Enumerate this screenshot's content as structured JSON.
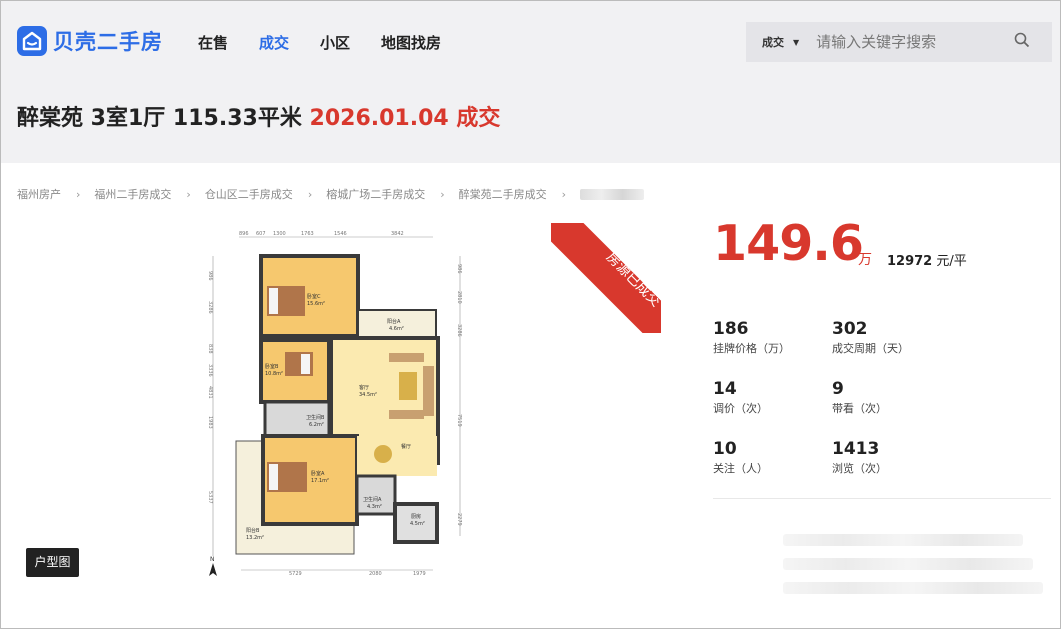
{
  "header": {
    "logo_text": "贝壳二手房",
    "nav": [
      "在售",
      "成交",
      "小区",
      "地图找房"
    ],
    "active_nav": "成交",
    "search": {
      "type_label": "成交",
      "placeholder": "请输入关键字搜索"
    }
  },
  "listing": {
    "name": "醉棠苑 3室1厅 115.33平米",
    "deal_date": "2026.01.04 成交"
  },
  "breadcrumb": [
    "福州房产",
    "福州二手房成交",
    "仓山区二手房成交",
    "榕城广场二手房成交",
    "醉棠苑二手房成交"
  ],
  "badge": {
    "sold": "房源已成交",
    "floorplan_tag": "户型图"
  },
  "floorplan": {
    "rooms": [
      "卧室C",
      "卧室B",
      "卧室A",
      "阳台A",
      "阳台B",
      "客厅",
      "餐厅",
      "卫生间B",
      "卫生间A",
      "厨房"
    ],
    "areas": [
      "15.6m²",
      "10.8m²",
      "17.1m²",
      "4.6m²",
      "13.2m²",
      "34.5m²",
      "6.2m²",
      "4.3m²",
      "4.5m²"
    ],
    "top_dims": [
      "896",
      "607",
      "1300",
      "1763",
      "1546",
      "3842"
    ],
    "bottom_dims": [
      "5729",
      "2080",
      "1979"
    ],
    "left_dims": [
      "986",
      "3286",
      "838",
      "3336",
      "4831",
      "1983",
      "5337"
    ],
    "right_dims": [
      "986",
      "2810",
      "3286",
      "7519",
      "2279"
    ]
  },
  "price": {
    "total": "149.6",
    "total_unit": "万",
    "unit_value": "12972",
    "unit_suffix": "元/平"
  },
  "stats": [
    {
      "value": "186",
      "label": "挂牌价格（万）"
    },
    {
      "value": "302",
      "label": "成交周期（天）"
    },
    {
      "value": "14",
      "label": "调价（次）"
    },
    {
      "value": "9",
      "label": "带看（次）"
    },
    {
      "value": "10",
      "label": "关注（人）"
    },
    {
      "value": "1413",
      "label": "浏览（次）"
    }
  ],
  "colors": {
    "brand_blue": "#2d6de6",
    "accent_red": "#d8382d",
    "header_bg": "#f1f1f3"
  }
}
